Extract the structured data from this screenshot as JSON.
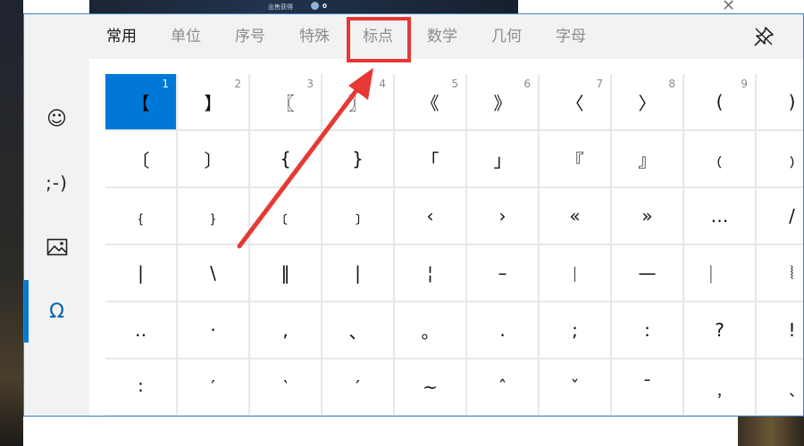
{
  "background": {
    "top_indicator_text": "出售获得",
    "top_indicator_count": "0",
    "close_glyph": "✕"
  },
  "sidebar": {
    "items": [
      {
        "name": "emoji",
        "glyph": "☺",
        "active": false
      },
      {
        "name": "kaomoji",
        "glyph": ";-)",
        "active": false
      },
      {
        "name": "gif",
        "glyph": "image-icon",
        "active": false
      },
      {
        "name": "symbols",
        "glyph": "Ω",
        "active": true
      }
    ]
  },
  "tabs": [
    {
      "label": "常用",
      "selected": true
    },
    {
      "label": "单位",
      "selected": false
    },
    {
      "label": "序号",
      "selected": false
    },
    {
      "label": "特殊",
      "selected": false
    },
    {
      "label": "标点",
      "selected": false
    },
    {
      "label": "数学",
      "selected": false
    },
    {
      "label": "几何",
      "selected": false
    },
    {
      "label": "字母",
      "selected": false
    }
  ],
  "pin_icon": "pin-icon",
  "symbol_grid": {
    "rows": [
      [
        {
          "s": "【",
          "n": "1"
        },
        {
          "s": "】",
          "n": "2"
        },
        {
          "s": "〖",
          "n": "3"
        },
        {
          "s": "〗",
          "n": "4"
        },
        {
          "s": "《",
          "n": "5"
        },
        {
          "s": "》",
          "n": "6"
        },
        {
          "s": "〈",
          "n": "7"
        },
        {
          "s": "〉",
          "n": "8"
        },
        {
          "s": "(",
          "n": "9"
        },
        {
          "s": ")",
          "n": ""
        }
      ],
      [
        {
          "s": "〔",
          "n": ""
        },
        {
          "s": "〕",
          "n": ""
        },
        {
          "s": "{",
          "n": ""
        },
        {
          "s": "}",
          "n": ""
        },
        {
          "s": "「",
          "n": ""
        },
        {
          "s": "」",
          "n": ""
        },
        {
          "s": "『",
          "n": ""
        },
        {
          "s": "』",
          "n": ""
        },
        {
          "s": "﹙",
          "n": ""
        },
        {
          "s": "﹚",
          "n": ""
        }
      ],
      [
        {
          "s": "﹛",
          "n": ""
        },
        {
          "s": "﹜",
          "n": ""
        },
        {
          "s": "﹝",
          "n": ""
        },
        {
          "s": "﹞",
          "n": ""
        },
        {
          "s": "‹",
          "n": ""
        },
        {
          "s": "›",
          "n": ""
        },
        {
          "s": "«",
          "n": ""
        },
        {
          "s": "»",
          "n": ""
        },
        {
          "s": "…",
          "n": ""
        },
        {
          "s": "/",
          "n": ""
        }
      ],
      [
        {
          "s": "|",
          "n": ""
        },
        {
          "s": "\\",
          "n": ""
        },
        {
          "s": "‖",
          "n": ""
        },
        {
          "s": "|",
          "n": ""
        },
        {
          "s": "¦",
          "n": ""
        },
        {
          "s": "–",
          "n": ""
        },
        {
          "s": "︱",
          "n": ""
        },
        {
          "s": "—",
          "n": ""
        },
        {
          "s": "︳",
          "n": ""
        },
        {
          "s": "⦚",
          "n": ""
        }
      ],
      [
        {
          "s": "‥",
          "n": ""
        },
        {
          "s": "·",
          "n": ""
        },
        {
          "s": ",",
          "n": ""
        },
        {
          "s": "、",
          "n": ""
        },
        {
          "s": "。",
          "n": ""
        },
        {
          "s": ".",
          "n": ""
        },
        {
          "s": ";",
          "n": ""
        },
        {
          "s": ":",
          "n": ""
        },
        {
          "s": "?",
          "n": ""
        },
        {
          "s": "!",
          "n": ""
        }
      ],
      [
        {
          "s": "∶",
          "n": ""
        },
        {
          "s": "′",
          "n": ""
        },
        {
          "s": "‵",
          "n": ""
        },
        {
          "s": "′",
          "n": ""
        },
        {
          "s": "~",
          "n": ""
        },
        {
          "s": "ˆ",
          "n": ""
        },
        {
          "s": "ˇ",
          "n": ""
        },
        {
          "s": "ˉ",
          "n": ""
        },
        {
          "s": "﹐",
          "n": ""
        },
        {
          "s": "﹑",
          "n": ""
        }
      ]
    ]
  },
  "annotation": {
    "highlight_color": "#e53935",
    "target": "标点"
  },
  "colors": {
    "accent": "#0078d7",
    "panel_bg": "#f2f2f2"
  }
}
